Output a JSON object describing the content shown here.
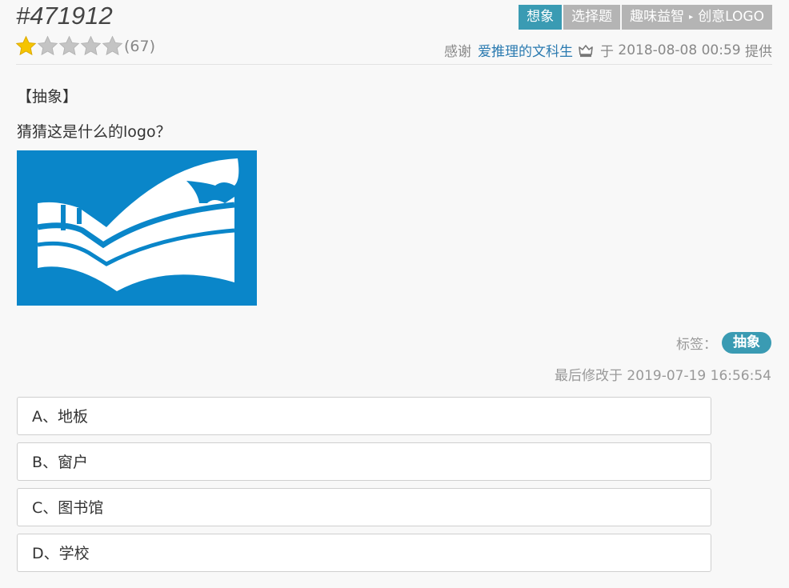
{
  "question_id": "#471912",
  "top_tags": [
    {
      "label": "想象",
      "primary": true
    },
    {
      "label": "选择题",
      "primary": false
    },
    {
      "label": "趣味益智",
      "primary": false,
      "arrow_text": "▸",
      "sub": "创意LOGO"
    }
  ],
  "rating": {
    "filled_stars": 1,
    "total_stars": 5,
    "count_text": "(67)"
  },
  "credit": {
    "thanks": "感谢",
    "user": "爱推理的文科生",
    "user_badge_icon": "crown-icon",
    "on": "于",
    "datetime": "2018-08-08 00:59",
    "provided": "提供"
  },
  "category": "【抽象】",
  "question": "猜猜这是什么的logo？",
  "labels": {
    "prefix": "标签：",
    "items": [
      "抽象"
    ]
  },
  "modified": "最后修改于 2019-07-19 16:56:54",
  "options": [
    "A、地板",
    "B、窗户",
    "C、图书馆",
    "D、学校"
  ],
  "colors": {
    "accent": "#3a9bb3",
    "logo_bg": "#0a86c9",
    "user_link": "#2a7ab0",
    "star": "#f5c400"
  }
}
